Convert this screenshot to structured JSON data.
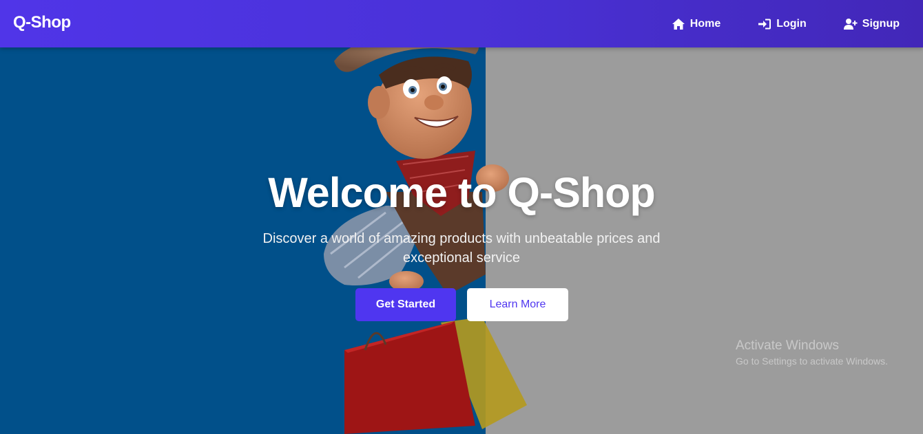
{
  "navbar": {
    "brand": "Q-Shop",
    "links": [
      {
        "label": "Home",
        "icon": "home-icon"
      },
      {
        "label": "Login",
        "icon": "sign-in-icon"
      },
      {
        "label": "Signup",
        "icon": "user-plus-icon"
      }
    ],
    "colors": {
      "gradient_start": "#5035e8",
      "gradient_end": "#4227b8"
    }
  },
  "hero": {
    "title": "Welcome to Q-Shop",
    "subtitle": "Discover a world of amazing products with unbeatable prices and exceptional service",
    "primary_button": "Get Started",
    "secondary_button": "Learn More",
    "colors": {
      "left_panel": "#01508a",
      "right_panel": "#9c9c9c",
      "accent": "#4f36f0"
    }
  },
  "watermark": {
    "title": "Activate Windows",
    "subtitle": "Go to Settings to activate Windows."
  }
}
